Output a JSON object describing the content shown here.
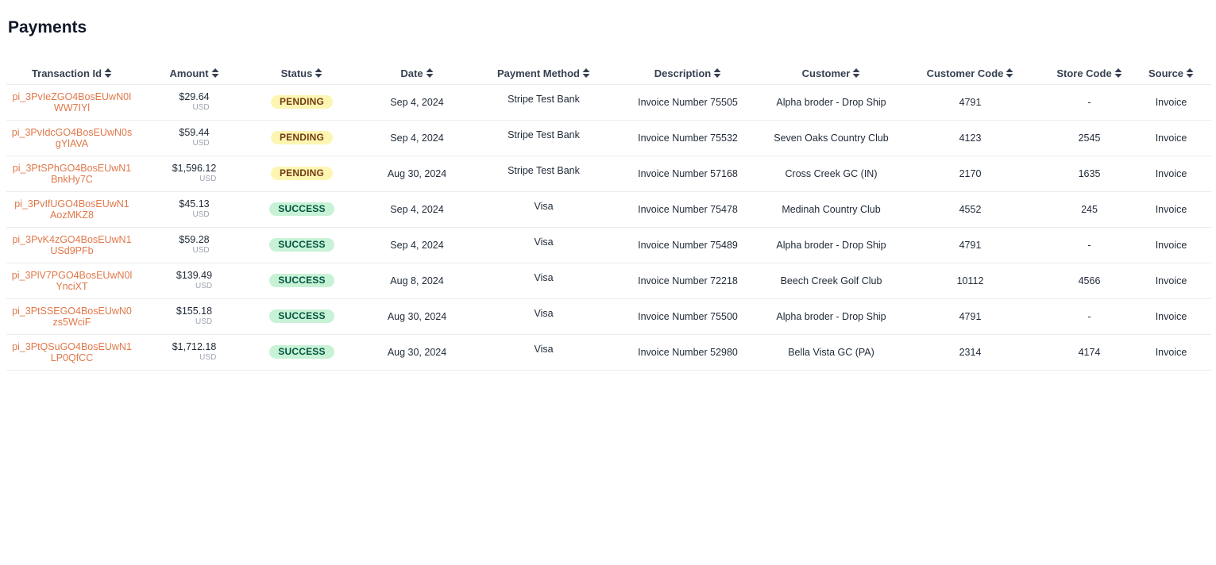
{
  "page": {
    "title": "Payments"
  },
  "table": {
    "columns": [
      "Transaction Id",
      "Amount",
      "Status",
      "Date",
      "Payment Method",
      "Description",
      "Customer",
      "Customer Code",
      "Store Code",
      "Source"
    ],
    "rows": [
      {
        "txn": "pi_3PvIeZGO4BosEUwN0IWW7IYl",
        "amount": "$29.64",
        "currency": "USD",
        "status": "PENDING",
        "date": "Sep 4, 2024",
        "method": "Stripe Test Bank",
        "description": "Invoice Number 75505",
        "customer": "Alpha broder - Drop Ship",
        "customer_code": "4791",
        "store_code": "-",
        "source": "Invoice"
      },
      {
        "txn": "pi_3PvIdcGO4BosEUwN0sgYlAVA",
        "amount": "$59.44",
        "currency": "USD",
        "status": "PENDING",
        "date": "Sep 4, 2024",
        "method": "Stripe Test Bank",
        "description": "Invoice Number 75532",
        "customer": "Seven Oaks Country Club",
        "customer_code": "4123",
        "store_code": "2545",
        "source": "Invoice"
      },
      {
        "txn": "pi_3PtSPhGO4BosEUwN1BnkHy7C",
        "amount": "$1,596.12",
        "currency": "USD",
        "status": "PENDING",
        "date": "Aug 30, 2024",
        "method": "Stripe Test Bank",
        "description": "Invoice Number 57168",
        "customer": "Cross Creek GC (IN)",
        "customer_code": "2170",
        "store_code": "1635",
        "source": "Invoice"
      },
      {
        "txn": "pi_3PvIfUGO4BosEUwN1AozMKZ8",
        "amount": "$45.13",
        "currency": "USD",
        "status": "SUCCESS",
        "date": "Sep 4, 2024",
        "method": "Visa",
        "description": "Invoice Number 75478",
        "customer": "Medinah Country Club",
        "customer_code": "4552",
        "store_code": "245",
        "source": "Invoice"
      },
      {
        "txn": "pi_3PvK4zGO4BosEUwN1USd9PFb",
        "amount": "$59.28",
        "currency": "USD",
        "status": "SUCCESS",
        "date": "Sep 4, 2024",
        "method": "Visa",
        "description": "Invoice Number 75489",
        "customer": "Alpha broder - Drop Ship",
        "customer_code": "4791",
        "store_code": "-",
        "source": "Invoice"
      },
      {
        "txn": "pi_3PlV7PGO4BosEUwN0lYnciXT",
        "amount": "$139.49",
        "currency": "USD",
        "status": "SUCCESS",
        "date": "Aug 8, 2024",
        "method": "Visa",
        "description": "Invoice Number 72218",
        "customer": "Beech Creek Golf Club",
        "customer_code": "10112",
        "store_code": "4566",
        "source": "Invoice"
      },
      {
        "txn": "pi_3PtSSEGO4BosEUwN0zs5WciF",
        "amount": "$155.18",
        "currency": "USD",
        "status": "SUCCESS",
        "date": "Aug 30, 2024",
        "method": "Visa",
        "description": "Invoice Number 75500",
        "customer": "Alpha broder - Drop Ship",
        "customer_code": "4791",
        "store_code": "-",
        "source": "Invoice"
      },
      {
        "txn": "pi_3PtQSuGO4BosEUwN1LP0QfCC",
        "amount": "$1,712.18",
        "currency": "USD",
        "status": "SUCCESS",
        "date": "Aug 30, 2024",
        "method": "Visa",
        "description": "Invoice Number 52980",
        "customer": "Bella Vista GC (PA)",
        "customer_code": "2314",
        "store_code": "4174",
        "source": "Invoice"
      }
    ]
  }
}
